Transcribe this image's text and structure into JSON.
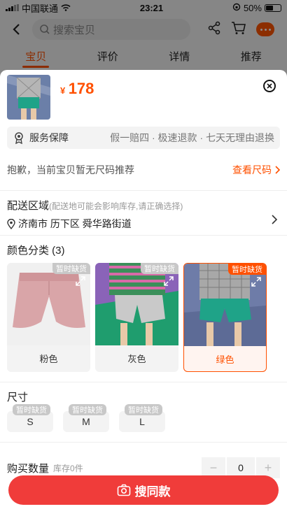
{
  "status_bar": {
    "carrier": "中国联通",
    "time": "23:21",
    "battery": "50%",
    "battery_level": 0.5
  },
  "nav": {
    "search_placeholder": "搜索宝贝"
  },
  "tabs": [
    {
      "label": "宝贝"
    },
    {
      "label": "评价"
    },
    {
      "label": "详情"
    },
    {
      "label": "推荐"
    }
  ],
  "product": {
    "currency": "¥",
    "price": "178"
  },
  "service": {
    "title": "服务保障",
    "detail": "假一赔四 · 极速退款 · 七天无理由退换"
  },
  "size_hint": {
    "text": "抱歉，当前宝贝暂无尺码推荐",
    "link": "查看尺码"
  },
  "delivery": {
    "title": "配送区域",
    "note": "(配送地可能会影响库存,请正确选择)",
    "address": "济南市 历下区 舜华路街道"
  },
  "colors": {
    "title": "颜色分类 (3)",
    "items": [
      {
        "label": "粉色",
        "tag": "暂时缺货"
      },
      {
        "label": "灰色",
        "tag": "暂时缺货"
      },
      {
        "label": "绿色",
        "tag": "暂时缺货"
      }
    ]
  },
  "sizes": {
    "title": "尺寸",
    "items": [
      {
        "label": "S",
        "tag": "暂时缺货"
      },
      {
        "label": "M",
        "tag": "暂时缺货"
      },
      {
        "label": "L",
        "tag": "暂时缺货"
      }
    ]
  },
  "quantity": {
    "title": "购买数量",
    "stock": "库存0件",
    "value": "0",
    "minus": "−",
    "plus": "+"
  },
  "cta": {
    "label": "搜同款"
  },
  "colors_theme": {
    "accent": "#ff5000",
    "cta": "#f03c3a"
  }
}
